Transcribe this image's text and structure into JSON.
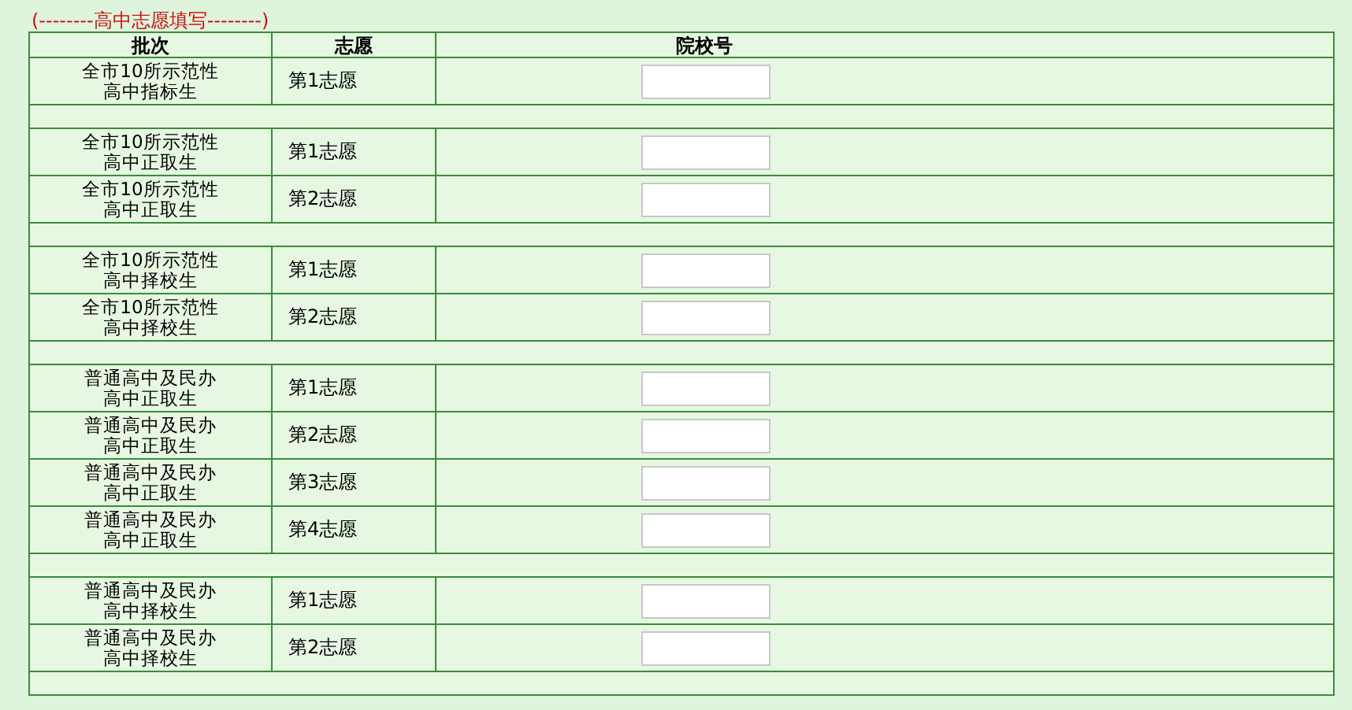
{
  "section_title": "(--------高中志愿填写--------)",
  "columns": [
    "批次",
    "志愿",
    "院校号"
  ],
  "groups": [
    {
      "rows": [
        {
          "batch": "全市10所示范性高中指标生",
          "choice": "第1志愿"
        }
      ]
    },
    {
      "rows": [
        {
          "batch": "全市10所示范性高中正取生",
          "choice": "第1志愿"
        },
        {
          "batch": "全市10所示范性高中正取生",
          "choice": "第2志愿"
        }
      ]
    },
    {
      "rows": [
        {
          "batch": "全市10所示范性高中择校生",
          "choice": "第1志愿"
        },
        {
          "batch": "全市10所示范性高中择校生",
          "choice": "第2志愿"
        }
      ]
    },
    {
      "rows": [
        {
          "batch": "普通高中及民办高中正取生",
          "choice": "第1志愿"
        },
        {
          "batch": "普通高中及民办高中正取生",
          "choice": "第2志愿"
        },
        {
          "batch": "普通高中及民办高中正取生",
          "choice": "第3志愿"
        },
        {
          "batch": "普通高中及民办高中正取生",
          "choice": "第4志愿"
        }
      ]
    },
    {
      "rows": [
        {
          "batch": "普通高中及民办高中择校生",
          "choice": "第1志愿"
        },
        {
          "batch": "普通高中及民办高中择校生",
          "choice": "第2志愿"
        }
      ]
    }
  ]
}
